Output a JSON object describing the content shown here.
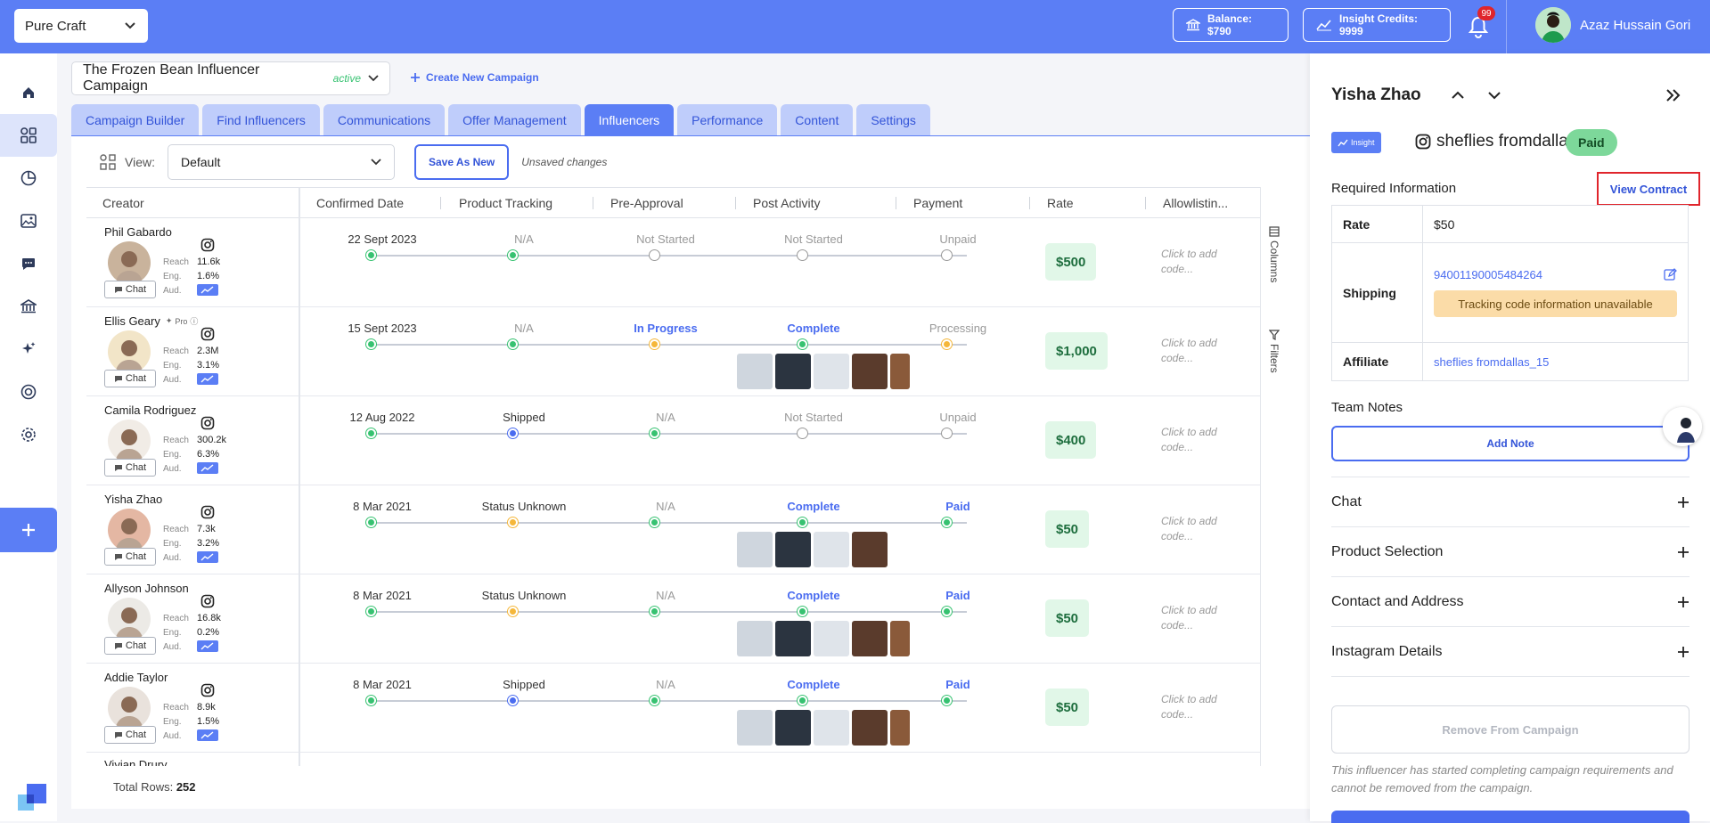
{
  "topbar": {
    "brand": "Pure Craft",
    "balance": "Balance: $790",
    "insight_credits": "Insight Credits: 9999",
    "notif_count": "99",
    "user_name": "Azaz Hussain Gori"
  },
  "campaign": {
    "name": "The Frozen Bean Influencer Campaign",
    "status": "active",
    "create_new": "Create New Campaign"
  },
  "tabs": [
    "Campaign Builder",
    "Find Influencers",
    "Communications",
    "Offer Management",
    "Influencers",
    "Performance",
    "Content",
    "Settings"
  ],
  "active_tab": "Influencers",
  "view": {
    "label": "View:",
    "selected": "Default",
    "save_as_new": "Save As New",
    "unsaved": "Unsaved changes"
  },
  "table": {
    "headers": [
      "Creator",
      "Confirmed Date",
      "Product Tracking",
      "Pre-Approval",
      "Post Activity",
      "Payment",
      "Rate",
      "Allowlistin..."
    ],
    "stat_labels": [
      "Reach",
      "Eng.",
      "Aud."
    ],
    "chat_label": "Chat",
    "allow_text": "Click to add code...",
    "pro_label": "Pro",
    "rows": [
      {
        "name": "Phil Gabardo",
        "pro": false,
        "reach": "11.6k",
        "eng": "1.6%",
        "confirmed": "22 Sept 2023",
        "tracking": "N/A",
        "preapproval": "Not Started",
        "post": "Not Started",
        "payment": "Unpaid",
        "rate": "$500",
        "thumbs": 0,
        "dots": [
          "green",
          "green",
          "empty",
          "empty",
          "empty"
        ],
        "styles": [
          "dark",
          "",
          "",
          "",
          ""
        ]
      },
      {
        "name": "Ellis Geary",
        "pro": true,
        "reach": "2.3M",
        "eng": "3.1%",
        "confirmed": "15 Sept 2023",
        "tracking": "N/A",
        "preapproval": "In Progress",
        "post": "Complete",
        "payment": "Processing",
        "rate": "$1,000",
        "thumbs": 5,
        "dots": [
          "green",
          "green",
          "orange",
          "green",
          "orange"
        ],
        "styles": [
          "dark",
          "",
          "blue",
          "blue",
          ""
        ]
      },
      {
        "name": "Camila Rodriguez",
        "pro": false,
        "reach": "300.2k",
        "eng": "6.3%",
        "confirmed": "12 Aug 2022",
        "tracking": "Shipped",
        "preapproval": "N/A",
        "post": "Not Started",
        "payment": "Unpaid",
        "rate": "$400",
        "thumbs": 0,
        "dots": [
          "green",
          "blue",
          "green",
          "empty",
          "empty"
        ],
        "styles": [
          "dark",
          "dark",
          "",
          "",
          ""
        ]
      },
      {
        "name": "Yisha Zhao",
        "pro": false,
        "reach": "7.3k",
        "eng": "3.2%",
        "confirmed": "8 Mar 2021",
        "tracking": "Status Unknown",
        "preapproval": "N/A",
        "post": "Complete",
        "payment": "Paid",
        "rate": "$50",
        "thumbs": 4,
        "dots": [
          "green",
          "orange",
          "green",
          "green",
          "green"
        ],
        "styles": [
          "dark",
          "dark",
          "",
          "blue",
          "blue"
        ]
      },
      {
        "name": "Allyson Johnson",
        "pro": false,
        "reach": "16.8k",
        "eng": "0.2%",
        "confirmed": "8 Mar 2021",
        "tracking": "Status Unknown",
        "preapproval": "N/A",
        "post": "Complete",
        "payment": "Paid",
        "rate": "$50",
        "thumbs": 5,
        "dots": [
          "green",
          "orange",
          "green",
          "green",
          "green"
        ],
        "styles": [
          "dark",
          "dark",
          "",
          "blue",
          "blue"
        ]
      },
      {
        "name": "Addie Taylor",
        "pro": false,
        "reach": "8.9k",
        "eng": "1.5%",
        "confirmed": "8 Mar 2021",
        "tracking": "Shipped",
        "preapproval": "N/A",
        "post": "Complete",
        "payment": "Paid",
        "rate": "$50",
        "thumbs": 5,
        "dots": [
          "green",
          "blue",
          "green",
          "green",
          "green"
        ],
        "styles": [
          "dark",
          "dark",
          "",
          "blue",
          "blue"
        ]
      }
    ],
    "partial_row": "Vivian Drury",
    "columns_label": "Columns",
    "filters_label": "Filters"
  },
  "footer": {
    "label": "Total Rows:",
    "count": "252"
  },
  "panel": {
    "name": "Yisha Zhao",
    "insight": "Insight",
    "handle": "sheflies fromdallas",
    "payment": "Paid",
    "required_title": "Required Information",
    "view_contract": "View Contract",
    "rate_label": "Rate",
    "rate_value": "$50",
    "shipping_label": "Shipping",
    "shipping_code": "94001190005484264",
    "tracking_warning": "Tracking code information unavailable",
    "affiliate_label": "Affiliate",
    "affiliate_value": "sheflies fromdallas_15",
    "team_notes": "Team Notes",
    "add_note": "Add Note",
    "sections": [
      "Chat",
      "Product Selection",
      "Contact and Address",
      "Instagram Details"
    ],
    "remove": "Remove From Campaign",
    "remove_note": "This influencer has started completing campaign requirements and cannot be removed from the campaign."
  },
  "colors": {
    "brand": "#5b7ef5",
    "accent": "#4a6cf0",
    "success": "#37c271",
    "warning": "#f5b73a",
    "alert": "#e0252c"
  },
  "icons": {
    "sidebar": [
      "home-icon",
      "campaigns-icon",
      "analytics-icon",
      "image-icon",
      "chat-icon",
      "bank-icon",
      "sparkle-icon",
      "target-icon",
      "settings-icon",
      "plus-icon"
    ]
  }
}
